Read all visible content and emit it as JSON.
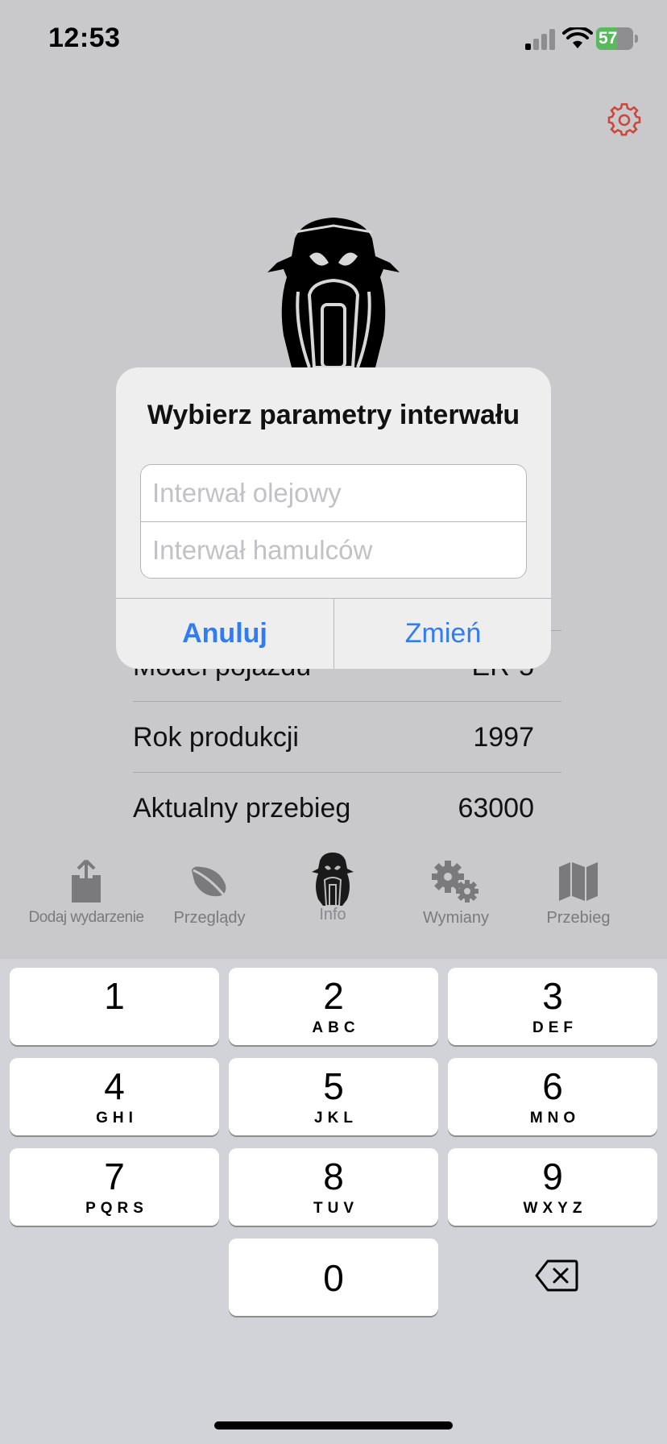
{
  "status_bar": {
    "time": "12:53",
    "battery": "57",
    "battery_level": 0.57
  },
  "dialog": {
    "title": "Wybierz parametry interwału",
    "oil_interval_placeholder": "Interwał olejowy",
    "brake_interval_placeholder": "Interwał hamulców",
    "cancel_label": "Anuluj",
    "change_label": "Zmień"
  },
  "vehicle_info": {
    "rows": [
      {
        "label": "Model pojazdu",
        "value": "ER-5"
      },
      {
        "label": "Rok produkcji",
        "value": "1997"
      },
      {
        "label": "Aktualny przebieg",
        "value": "63000"
      }
    ]
  },
  "tab_bar": {
    "tabs": [
      {
        "label": "Dodaj wydarzenie",
        "icon": "share-icon"
      },
      {
        "label": "Przeglądy",
        "icon": "leaf-icon"
      },
      {
        "label": "Info",
        "icon": "motorcycle-icon"
      },
      {
        "label": "Wymiany",
        "icon": "gears-icon"
      },
      {
        "label": "Przebieg",
        "icon": "map-icon"
      }
    ]
  },
  "keyboard": {
    "keys": [
      {
        "num": "1",
        "letters": ""
      },
      {
        "num": "2",
        "letters": "ABC"
      },
      {
        "num": "3",
        "letters": "DEF"
      },
      {
        "num": "4",
        "letters": "GHI"
      },
      {
        "num": "5",
        "letters": "JKL"
      },
      {
        "num": "6",
        "letters": "MNO"
      },
      {
        "num": "7",
        "letters": "PQRS"
      },
      {
        "num": "8",
        "letters": "TUV"
      },
      {
        "num": "9",
        "letters": "WXYZ"
      },
      {
        "num": "0",
        "letters": ""
      }
    ]
  },
  "colors": {
    "accent": "#2f7cf6",
    "settings_icon": "#c9473b",
    "battery": "#59b95e"
  }
}
